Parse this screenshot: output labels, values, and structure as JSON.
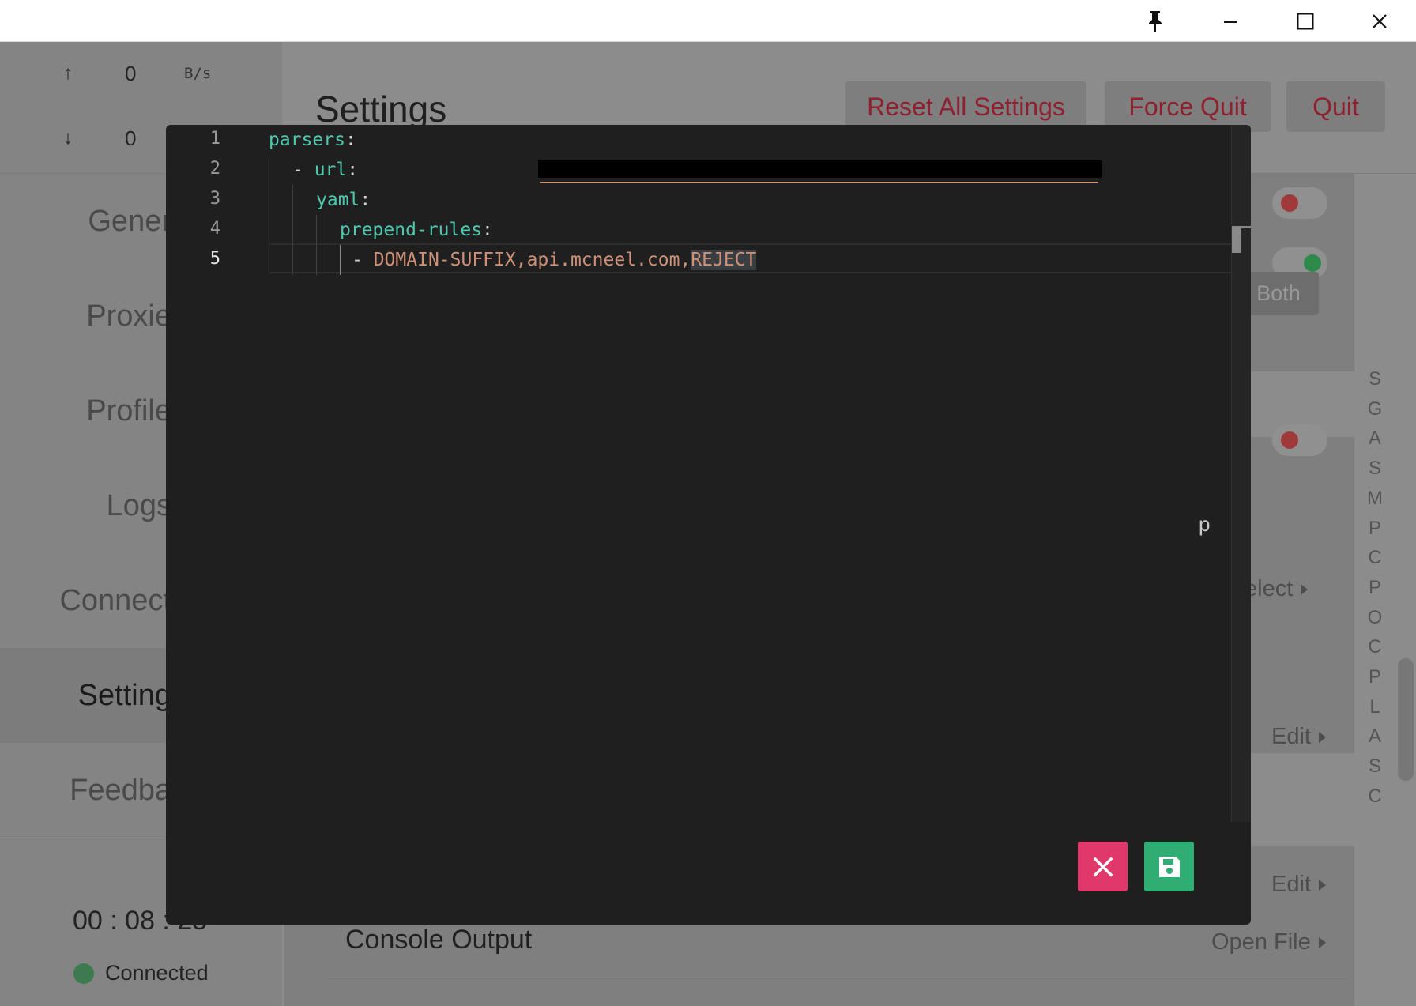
{
  "window": {
    "pin_icon": "pin-icon",
    "minimize_icon": "minimize-icon",
    "maximize_icon": "maximize-icon",
    "close_icon": "close-icon"
  },
  "traffic": {
    "up_arrow": "↑",
    "down_arrow": "↓",
    "up_value": "0",
    "down_value": "0",
    "unit": "B/s"
  },
  "sidebar": {
    "items": [
      {
        "label": "Gener"
      },
      {
        "label": "Proxie"
      },
      {
        "label": "Profile"
      },
      {
        "label": "Logs"
      },
      {
        "label": "Connect"
      },
      {
        "label": "Setting"
      },
      {
        "label": "Feedba"
      }
    ],
    "timer": "00 : 08 : 25",
    "status": "Connected"
  },
  "main": {
    "title": "Settings",
    "reset_button": "Reset All Settings",
    "force_quit_button": "Force Quit",
    "quit_button": "Quit",
    "both_button": "Both",
    "side_letters": [
      "S",
      "G",
      "A",
      "S",
      "M",
      "P",
      "C",
      "P",
      "O",
      "C",
      "P",
      "L",
      "A",
      "S",
      "C"
    ],
    "select_link": "elect",
    "edit_link_1": "Edit",
    "edit_link_2": "Edit",
    "console_label": "Console Output",
    "open_file_link": "Open File"
  },
  "editor": {
    "line_numbers": [
      "1",
      "2",
      "3",
      "4",
      "5"
    ],
    "lines": {
      "l1_key": "parsers",
      "l2_dash": "- ",
      "l2_key": "url",
      "l3_key": "yaml",
      "l4_key": "prepend-rules",
      "l5_dash": "- ",
      "l5_value": "DOMAIN-SUFFIX,api.mcneel.com,",
      "l5_selected": "REJECT"
    },
    "colon": ":",
    "stray_text": "p",
    "cancel_icon": "close-icon",
    "save_icon": "save-icon",
    "colors": {
      "key": "#4ec9b0",
      "string": "#ce9178",
      "cancel": "#e0386b",
      "save": "#2fae74"
    }
  }
}
